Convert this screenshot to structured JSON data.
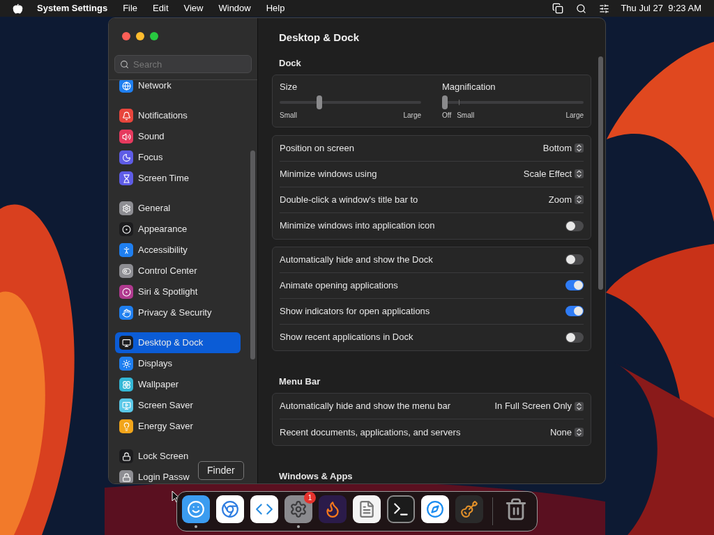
{
  "menu_bar": {
    "app": "System Settings",
    "menus": [
      "File",
      "Edit",
      "View",
      "Window",
      "Help"
    ],
    "clock": "Thu Jul 27  9:23 AM"
  },
  "sidebar": {
    "search": {
      "placeholder": "Search"
    },
    "groups": [
      [
        {
          "label": "Network",
          "color": "#1f7ff0",
          "selected": false
        }
      ],
      [
        {
          "label": "Notifications",
          "color": "#e8453c",
          "selected": false
        },
        {
          "label": "Sound",
          "color": "#e63a5e",
          "selected": false
        },
        {
          "label": "Focus",
          "color": "#5e5ce6",
          "selected": false
        },
        {
          "label": "Screen Time",
          "color": "#5e5ce6",
          "selected": false
        }
      ],
      [
        {
          "label": "General",
          "color": "#8e8e93",
          "selected": false
        },
        {
          "label": "Appearance",
          "color": "#1c1c1e",
          "selected": false
        },
        {
          "label": "Accessibility",
          "color": "#1f7ff0",
          "selected": false
        },
        {
          "label": "Control Center",
          "color": "#8e8e93",
          "selected": false
        },
        {
          "label": "Siri & Spotlight",
          "color": "#b03a8f",
          "selected": false
        },
        {
          "label": "Privacy & Security",
          "color": "#1f7ff0",
          "selected": false
        }
      ],
      [
        {
          "label": "Desktop & Dock",
          "color": "#1c1c1e",
          "selected": true
        },
        {
          "label": "Displays",
          "color": "#1f7ff0",
          "selected": false
        },
        {
          "label": "Wallpaper",
          "color": "#34b7d6",
          "selected": false
        },
        {
          "label": "Screen Saver",
          "color": "#5ac8e8",
          "selected": false
        },
        {
          "label": "Energy Saver",
          "color": "#f2a51a",
          "selected": false
        }
      ],
      [
        {
          "label": "Lock Screen",
          "color": "#1c1c1e",
          "selected": false
        },
        {
          "label": "Login Passw",
          "color": "#8e8e93",
          "selected": false
        }
      ]
    ]
  },
  "content": {
    "title": "Desktop & Dock",
    "sections": [
      {
        "heading": "Dock",
        "sliders": [
          {
            "label": "Size",
            "level": 0.27,
            "min_label": "Small",
            "max_label": "Large"
          },
          {
            "label": "Magnification",
            "level": 0,
            "off_label": "Off",
            "min_label": "Small",
            "max_label": "Large"
          }
        ],
        "groups": [
          [
            {
              "kind": "popup",
              "label": "Position on screen",
              "value": "Bottom"
            },
            {
              "kind": "popup",
              "label": "Minimize windows using",
              "value": "Scale Effect"
            },
            {
              "kind": "popup",
              "label": "Double-click a window's title bar to",
              "value": "Zoom"
            },
            {
              "kind": "toggle",
              "label": "Minimize windows into application icon",
              "on": false
            }
          ],
          [
            {
              "kind": "toggle",
              "label": "Automatically hide and show the Dock",
              "on": false
            },
            {
              "kind": "toggle",
              "label": "Animate opening applications",
              "on": true
            },
            {
              "kind": "toggle",
              "label": "Show indicators for open applications",
              "on": true
            },
            {
              "kind": "toggle",
              "label": "Show recent applications in Dock",
              "on": false
            }
          ]
        ]
      },
      {
        "heading": "Menu Bar",
        "groups": [
          [
            {
              "kind": "popup",
              "label": "Automatically hide and show the menu bar",
              "value": "In Full Screen Only"
            },
            {
              "kind": "popup",
              "label": "Recent documents, applications, and servers",
              "value": "None"
            }
          ]
        ]
      },
      {
        "heading": "Windows & Apps"
      }
    ]
  },
  "tooltip": "Finder",
  "dock": {
    "apps": [
      {
        "kind": "finder",
        "running": true
      },
      {
        "kind": "chrome",
        "running": false
      },
      {
        "kind": "vscode",
        "running": false
      },
      {
        "kind": "settings",
        "running": true,
        "badge": "1"
      },
      {
        "kind": "firefox",
        "running": false
      },
      {
        "kind": "textedit",
        "running": false
      },
      {
        "kind": "terminal",
        "running": false
      },
      {
        "kind": "safari",
        "running": false
      },
      {
        "kind": "garageband",
        "running": false
      }
    ]
  }
}
